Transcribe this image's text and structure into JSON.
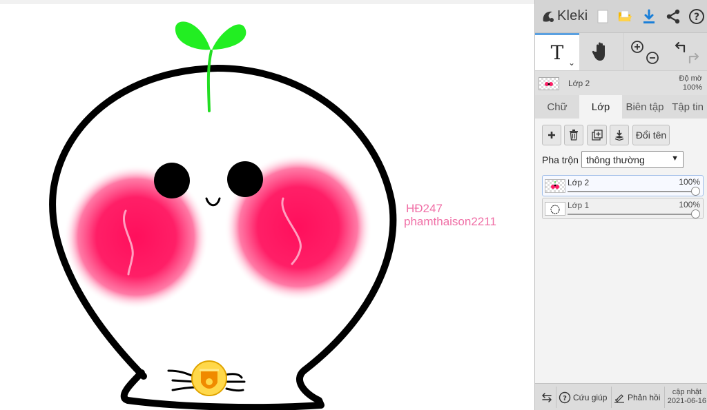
{
  "app": {
    "name": "Kleki"
  },
  "canvas": {
    "watermark_line1": "HĐ247",
    "watermark_line2": "phamthaison2211"
  },
  "toolbar": {
    "icons": [
      "new-document-icon",
      "open-folder-icon",
      "download-icon",
      "share-icon",
      "help-icon"
    ],
    "tools": [
      "text-tool-icon",
      "hand-tool-icon",
      "zoom-in-icon",
      "zoom-out-icon",
      "undo-icon",
      "redo-icon"
    ]
  },
  "current_layer": {
    "name": "Lớp 2",
    "opacity_label": "Độ mờ",
    "opacity_value": "100%"
  },
  "tabs": [
    {
      "label": "Chữ",
      "active": false
    },
    {
      "label": "Lớp",
      "active": true
    },
    {
      "label": "Biên tập",
      "active": false
    },
    {
      "label": "Tập tin",
      "active": false
    }
  ],
  "layer_panel": {
    "buttons": [
      "add-layer-icon",
      "delete-layer-icon",
      "duplicate-layer-icon",
      "merge-down-icon"
    ],
    "rename_label": "Đổi tên",
    "blend_label": "Pha trộn",
    "blend_value": "thông thường",
    "layers": [
      {
        "name": "Lớp 2",
        "opacity": "100%",
        "selected": true
      },
      {
        "name": "Lớp 1",
        "opacity": "100%",
        "selected": false
      }
    ]
  },
  "bottom": {
    "help_label": "Cứu giúp",
    "feedback_label": "Phản hồi",
    "update_label": "cập nhật",
    "update_date": "2021-06-16"
  },
  "colors": {
    "accent": "#3a8ee6",
    "download": "#1a7fd8",
    "folder": "#f5b800",
    "watermark": "#f06fa6",
    "blush": "#ff1f67",
    "sprout": "#22dd22"
  }
}
